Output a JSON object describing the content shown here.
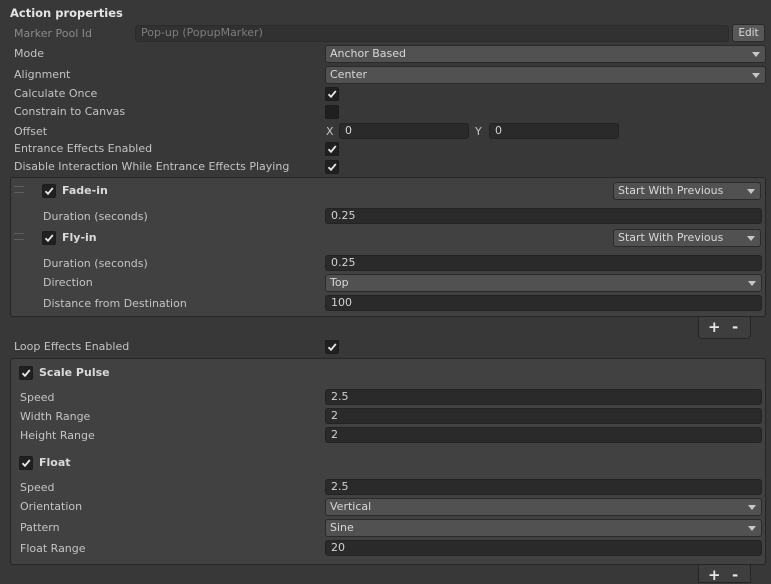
{
  "header": {
    "title": "Action properties"
  },
  "marker_pool": {
    "label": "Marker Pool Id",
    "value": "Pop-up (PopupMarker)",
    "edit_label": "Edit"
  },
  "mode": {
    "label": "Mode",
    "value": "Anchor Based"
  },
  "alignment": {
    "label": "Alignment",
    "value": "Center"
  },
  "calculate_once": {
    "label": "Calculate Once",
    "checked": true
  },
  "constrain": {
    "label": "Constrain to Canvas",
    "checked": false
  },
  "offset": {
    "label": "Offset",
    "x_label": "X",
    "x_value": "0",
    "y_label": "Y",
    "y_value": "0"
  },
  "entrance_enabled": {
    "label": "Entrance Effects Enabled",
    "checked": true
  },
  "disable_interaction": {
    "label": "Disable Interaction While Entrance Effects Playing",
    "checked": true
  },
  "entrance": {
    "fade_in": {
      "title": "Fade-in",
      "checked": true,
      "timing": "Start With Previous",
      "duration_label": "Duration (seconds)",
      "duration_value": "0.25"
    },
    "fly_in": {
      "title": "Fly-in",
      "checked": true,
      "timing": "Start With Previous",
      "duration_label": "Duration (seconds)",
      "duration_value": "0.25",
      "direction_label": "Direction",
      "direction_value": "Top",
      "distance_label": "Distance from Destination",
      "distance_value": "100"
    }
  },
  "list_controls": {
    "add": "+",
    "remove": "-"
  },
  "loop_enabled": {
    "label": "Loop Effects Enabled",
    "checked": true
  },
  "loop": {
    "scale_pulse": {
      "title": "Scale Pulse",
      "checked": true,
      "speed_label": "Speed",
      "speed_value": "2.5",
      "width_label": "Width Range",
      "width_value": "2",
      "height_label": "Height Range",
      "height_value": "2"
    },
    "float": {
      "title": "Float",
      "checked": true,
      "speed_label": "Speed",
      "speed_value": "2.5",
      "orientation_label": "Orientation",
      "orientation_value": "Vertical",
      "pattern_label": "Pattern",
      "pattern_value": "Sine",
      "range_label": "Float Range",
      "range_value": "20"
    }
  }
}
